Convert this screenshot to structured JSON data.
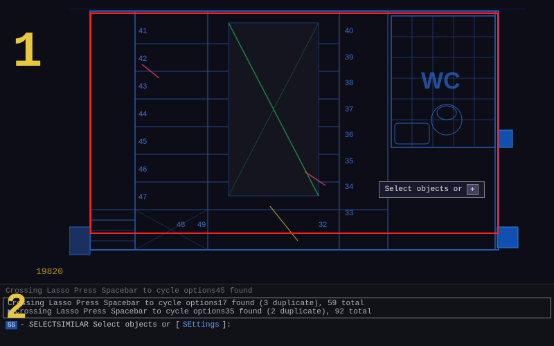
{
  "canvas": {
    "background_color": "#0d0d18",
    "label_1": "1",
    "label_2": "2",
    "coordinate": "19820"
  },
  "tooltip": {
    "text": "Select objects or",
    "button": "+"
  },
  "room_numbers": {
    "top": "40",
    "r1": "41",
    "r2": "42",
    "r3": "43",
    "r4": "44",
    "r5": "45",
    "r6": "46",
    "r7": "47",
    "right_col": [
      "39",
      "38",
      "37",
      "36",
      "35",
      "34",
      "33"
    ],
    "bottom": [
      "48",
      "49",
      "32"
    ],
    "wc": "WC"
  },
  "status_bar": {
    "line_gray": "Crossing Lasso  Press Spacebar to cycle options45 found",
    "line_1": "Crossing Lasso  Press Spacebar to cycle options17 found (3 duplicate), 59 total",
    "line_2": "Crossing Lasso  Press Spacebar to cycle options35 found (2 duplicate), 92 total",
    "cmd_prefix": "- SELECTSIMILAR Select objects or [",
    "cmd_option": "SEttings",
    "cmd_suffix": "]:"
  }
}
